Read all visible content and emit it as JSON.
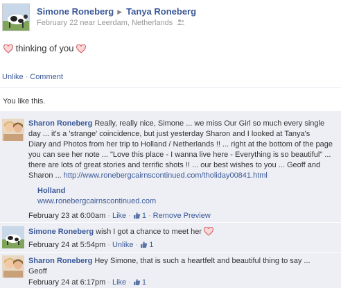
{
  "header": {
    "author": "Simone Roneberg",
    "recipient": "Tanya Roneberg",
    "date": "February 22",
    "location_text": "near Leerdam, Netherlands"
  },
  "post": {
    "message": "thinking of you"
  },
  "actions": {
    "unlike": "Unlike",
    "comment": "Comment"
  },
  "likes": {
    "text": "You like this."
  },
  "comments": [
    {
      "author": "Sharon Roneberg",
      "lines": [
        "Really, really nice, Simone ... we miss Our Girl so much every single",
        "day ... it's a 'strange' coincidence, but just yesterday Sharon and I looked at Tanya's",
        "Diary and Photos from her trip to Holland / Netherlands !! ... right at the bottom of the page",
        "you can see her note ... \"Love this place - I wanna live here - Everything is so beautiful\" ...",
        "there are lots of great stories and terrific shots !! ... our best wishes to you ... Geoff and",
        "Sharon ... "
      ],
      "link": "http://www.ronebergcairnscontinued.com/tholiday00841.html",
      "attachment": {
        "title": "Holland",
        "url": "www.ronebergcairnscontinued.com"
      },
      "time": "February 23 at 6:00am",
      "like_label": "Like",
      "like_count": "1",
      "remove_label": "Remove Preview"
    },
    {
      "author": "Simone Roneberg",
      "text": "wish I got a chance to meet her",
      "time": "February 24 at 5:54pm",
      "like_label": "Unlike",
      "like_count": "1"
    },
    {
      "author": "Sharon Roneberg",
      "lines": [
        "Hey Simone, that is such a heartfelt and beautiful thing to say ...",
        "Geoff"
      ],
      "time": "February 24 at 6:17pm",
      "like_label": "Like",
      "like_count": "1"
    }
  ],
  "colors": {
    "link": "#3b5998",
    "meta": "#999999",
    "comment_bg": "#edeff4",
    "heart": "#e9595f"
  },
  "icons": [
    "profile-photo",
    "people-icon",
    "heart-icon",
    "thumbs-up-icon"
  ]
}
